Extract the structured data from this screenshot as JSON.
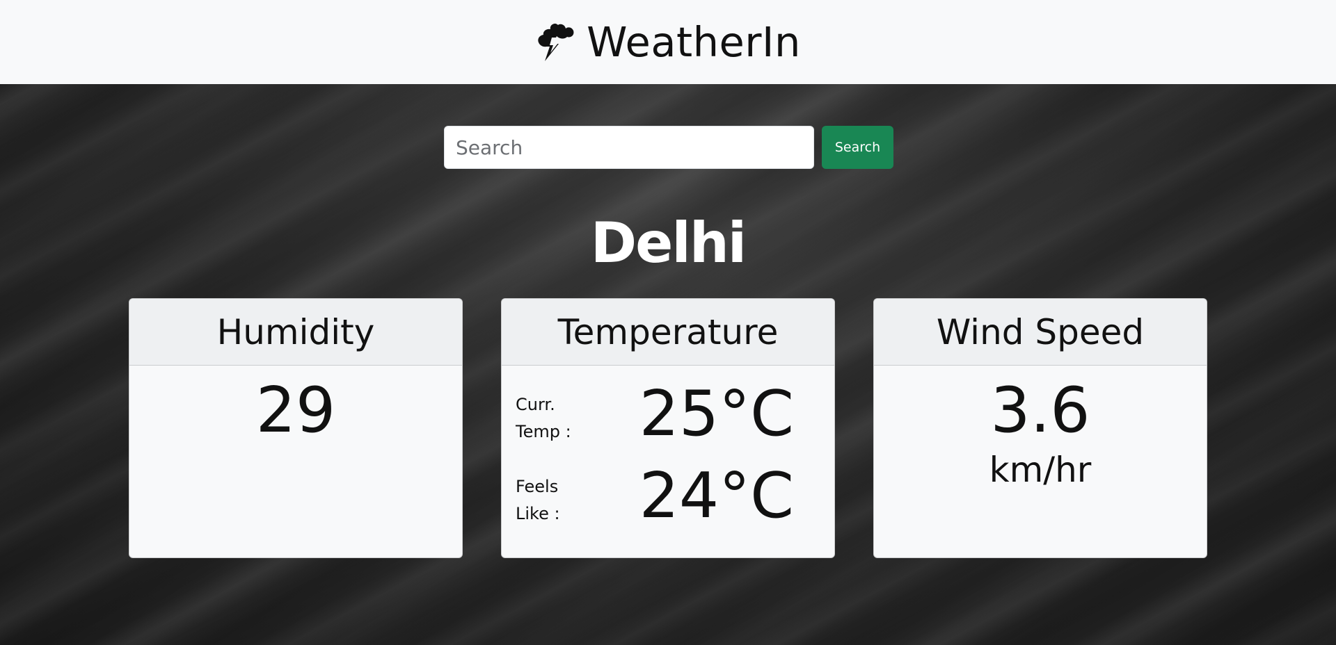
{
  "navbar": {
    "brand_name": "WeatherIn",
    "brand_icon": "cloud-lightning-icon"
  },
  "search": {
    "placeholder": "Search",
    "value": "",
    "button_label": "Search",
    "button_color": "#198754"
  },
  "city": {
    "name": "Delhi"
  },
  "cards": {
    "humidity": {
      "title": "Humidity",
      "value": "29"
    },
    "temperature": {
      "title": "Temperature",
      "current_label_line1": "Curr.",
      "current_label_line2": "Temp :",
      "current_value": "25°C",
      "feels_label_line1": "Feels",
      "feels_label_line2": "Like :",
      "feels_value": "24°C"
    },
    "wind": {
      "title": "Wind Speed",
      "value": "3.6",
      "unit": "km/hr"
    }
  }
}
